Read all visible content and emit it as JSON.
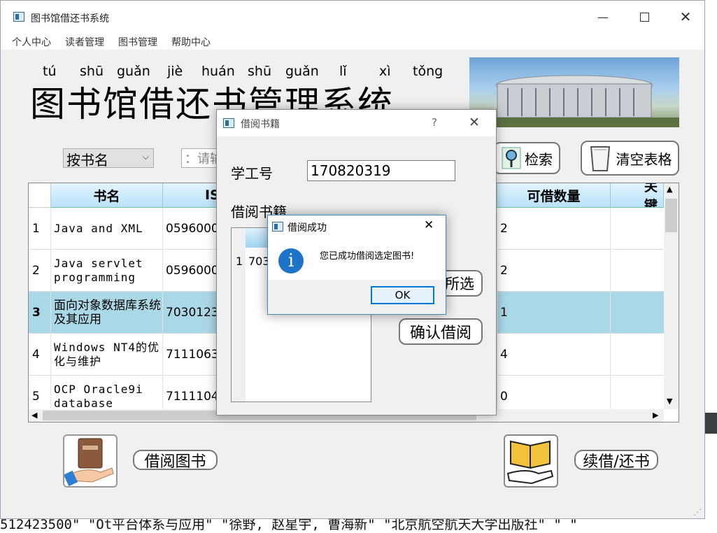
{
  "window": {
    "title": "图书馆借还书系统"
  },
  "menu": [
    "个人中心",
    "读者管理",
    "图书管理",
    "帮助中心"
  ],
  "header": {
    "pinyin": [
      "tú",
      "shū",
      "guǎn",
      "jiè",
      "huán",
      "shū",
      "guǎn",
      "lǐ",
      "xì",
      "tǒng"
    ],
    "title": "图书馆借还书管理系统"
  },
  "search": {
    "mode": "按书名",
    "placeholder": "：请输",
    "search_label": "检索",
    "clear_label": "清空表格"
  },
  "table": {
    "columns": [
      "书名",
      "IS",
      "可借数量",
      "关键"
    ],
    "rows": [
      {
        "num": "1",
        "name": "Java and XML",
        "isbn": "0596000",
        "count": "2"
      },
      {
        "num": "2",
        "name": "Java servlet programming",
        "isbn": "0596000",
        "count": "2"
      },
      {
        "num": "3",
        "name": "面向对象数据库系统及其应用",
        "isbn": "7030123",
        "count": "1"
      },
      {
        "num": "4",
        "name": "Windows NT4的优化与维护",
        "isbn": "7111063",
        "count": "4"
      },
      {
        "num": "5",
        "name": " OCP Oracle9i database",
        "isbn": "7111104",
        "count": "0"
      }
    ]
  },
  "borrow_dialog": {
    "title": "借阅书籍",
    "help": "?",
    "student_id_label": "学工号",
    "student_id_value": "170820319",
    "books_label": "借阅书籍",
    "row_num": "1",
    "row_value": "703",
    "delete_label": "所选",
    "confirm_label": "确认借阅"
  },
  "success_dialog": {
    "title": "借阅成功",
    "message": "您已成功借阅选定图书!",
    "ok_label": "OK"
  },
  "actions": {
    "borrow_label": "借阅图书",
    "return_label": "续借/还书"
  },
  "background": {
    "text": "512423500\" \"Ot平台体系与应用\" \"徐野, 赵星宇, 曹海新\" \"北京航空航天大学出版社\" \" \"",
    "left_digit": "5"
  }
}
